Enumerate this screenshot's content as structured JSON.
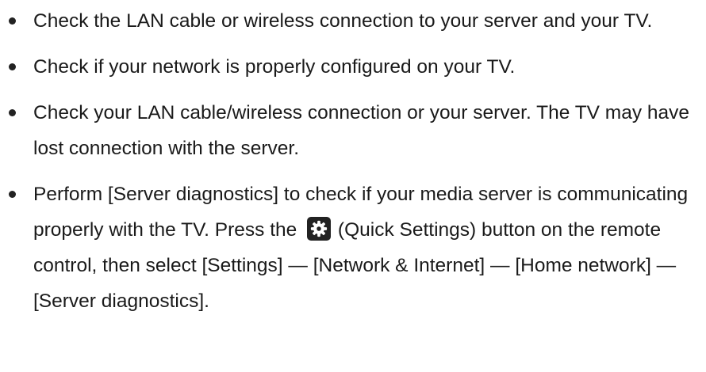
{
  "items": [
    {
      "text": "Check the LAN cable or wireless connection to your server and your TV."
    },
    {
      "text": "Check if your network is properly configured on your TV."
    },
    {
      "text": "Check your LAN cable/wireless connection or your server. The TV may have lost connection with the server."
    },
    {
      "text_before": "Perform [Server diagnostics] to check if your media server is communicating properly with the TV. Press the",
      "icon": "gear-icon",
      "text_after": "(Quick Settings) button on the remote control, then select [Settings] — [Network & Internet] — [Home network] — [Server diagnostics]."
    }
  ],
  "colors": {
    "text": "#1a1a1a",
    "bullet": "#222222",
    "icon_bg": "#222222",
    "icon_fg": "#ffffff"
  }
}
